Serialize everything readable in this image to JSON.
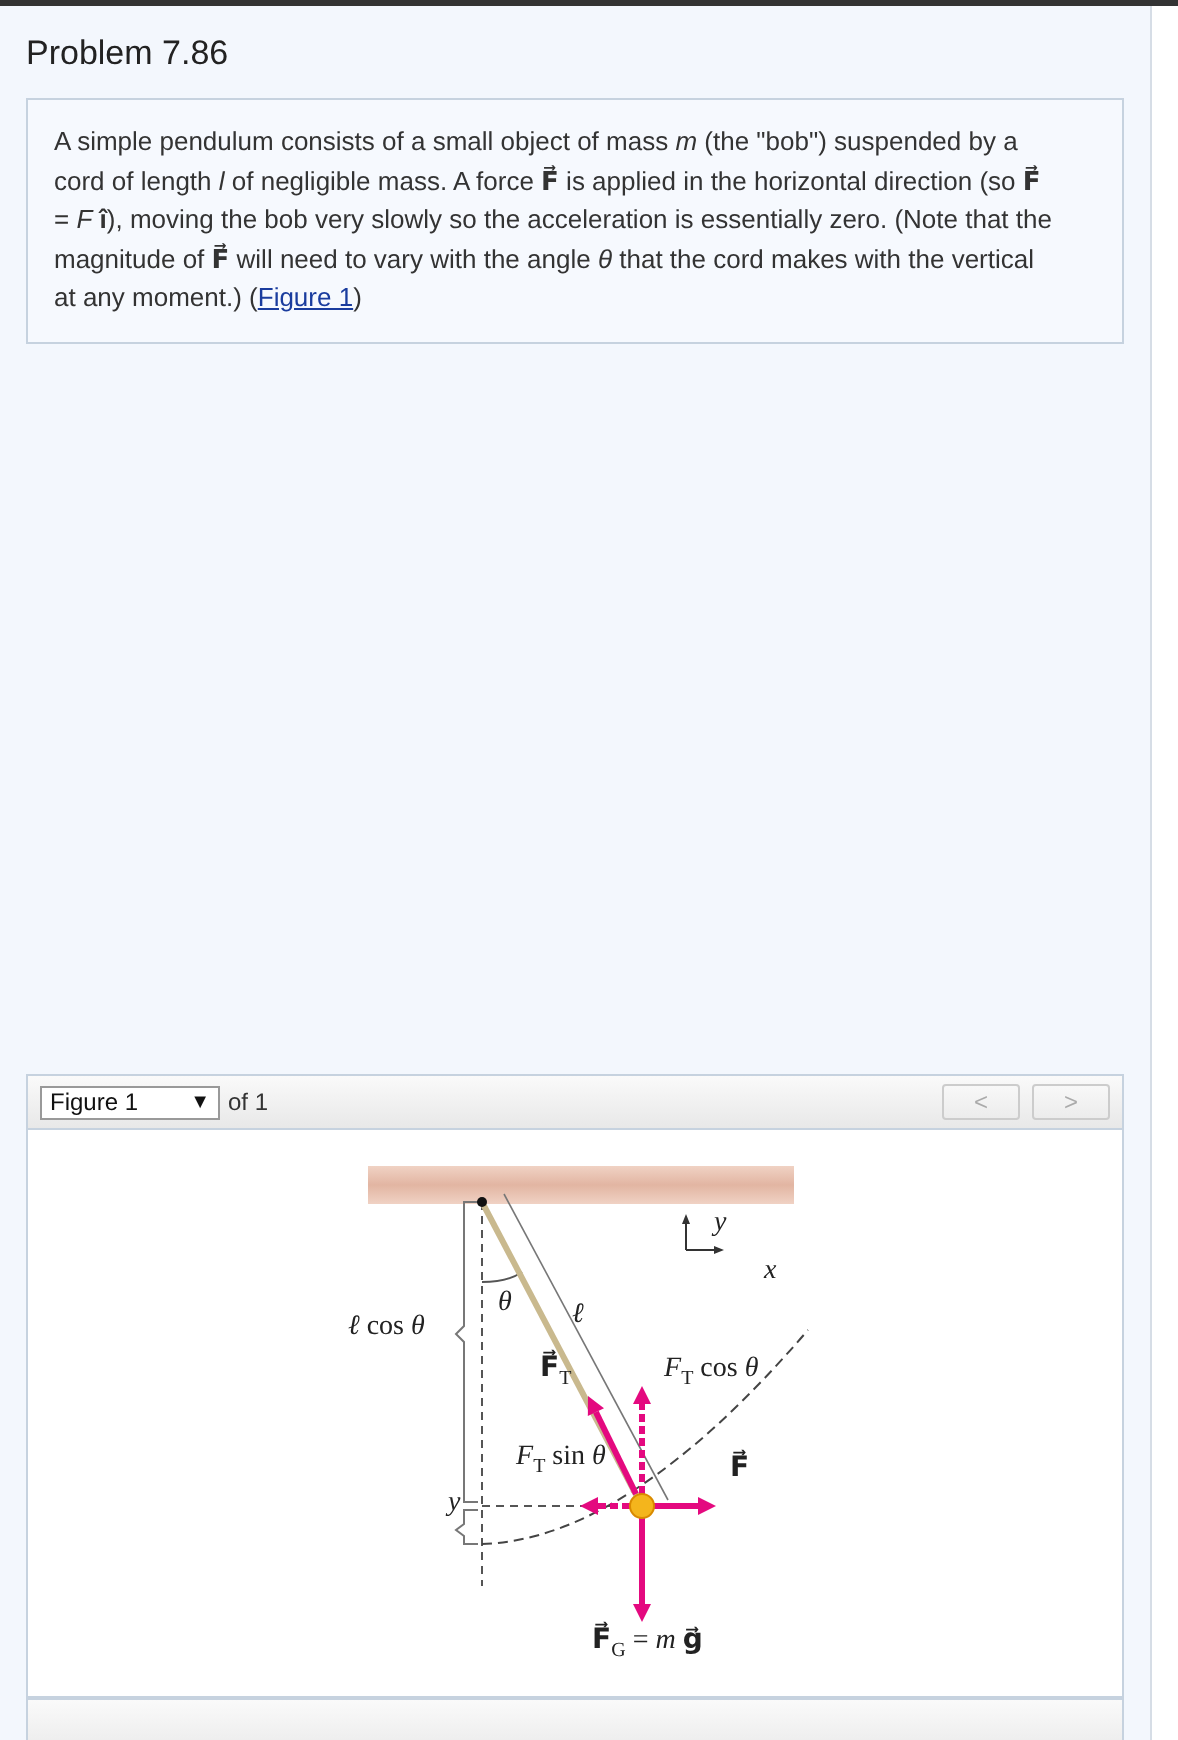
{
  "title": "Problem 7.86",
  "problem": {
    "text": "A simple pendulum consists of a small object of mass *m* (the \"bob\") suspended by a cord of length *l* of negligible mass. A force **F⃗** is applied in the horizontal direction (so **F⃗** = *F* **î**), moving the bob very slowly so the acceleration is essentially zero. (Note that the magnitude of **F⃗** will need to vary with the angle *θ* that the cord makes with the vertical at any moment.) (",
    "link": "Figure 1",
    "text_end": ")"
  },
  "figure_nav": {
    "selector": "Figure 1",
    "caret": "▼",
    "count": "of 1",
    "prev": {
      "label": "<",
      "disabled": true
    },
    "next": {
      "label": ">",
      "disabled": true
    }
  },
  "figure": {
    "labels": [
      {
        "text": "*y*"
      },
      {
        "text": "*x*"
      },
      {
        "text": "*θ*"
      },
      {
        "text": "*ℓ*"
      },
      {
        "text": "*ℓ* cos *θ*"
      },
      {
        "text": "**F⃗**$_{T}$"
      },
      {
        "text": "*F*$_{T}$ cos *θ*"
      },
      {
        "text": "*F*$_{T}$ sin *θ*"
      },
      {
        "text": "**F⃗**"
      },
      {
        "text": "*y*"
      },
      {
        "text": "**F⃗**$_{G}$ = *m* **g⃗**"
      }
    ]
  }
}
